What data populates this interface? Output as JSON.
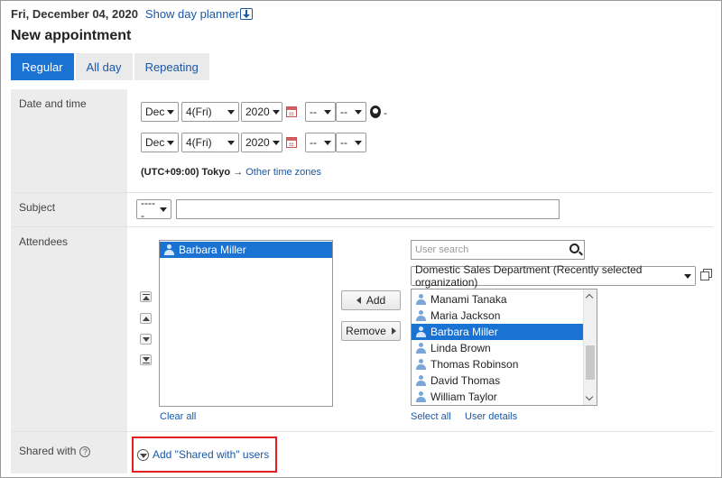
{
  "header": {
    "date": "Fri, December 04, 2020",
    "planner_link": "Show day planner",
    "page_title": "New appointment"
  },
  "tabs": [
    {
      "label": "Regular",
      "active": true
    },
    {
      "label": "All day",
      "active": false
    },
    {
      "label": "Repeating",
      "active": false
    }
  ],
  "labels": {
    "date_time": "Date and time",
    "subject": "Subject",
    "attendees": "Attendees",
    "shared_with": "Shared with"
  },
  "start": {
    "month": "Dec",
    "day": "4(Fri)",
    "year": "2020",
    "hour": "--",
    "minute": "--"
  },
  "end": {
    "month": "Dec",
    "day": "4(Fri)",
    "year": "2020",
    "hour": "--",
    "minute": "--"
  },
  "range_dash": "-",
  "timezone": {
    "label": "(UTC+09:00) Tokyo",
    "arrow": "→",
    "link": "Other time zones"
  },
  "subject": {
    "menu_value": "-----",
    "text": ""
  },
  "attendees": {
    "selected": [
      "Barbara Miller"
    ],
    "clear_all": "Clear all",
    "add_button": "Add",
    "remove_button": "Remove"
  },
  "user_search": {
    "placeholder": "User search",
    "organization": "Domestic Sales Department (Recently selected organization)",
    "candidates": [
      "Manami Tanaka",
      "Maria Jackson",
      "Barbara Miller",
      "Linda Brown",
      "Thomas Robinson",
      "David Thomas",
      "William Taylor"
    ],
    "selected_candidate": "Barbara Miller",
    "select_all": "Select all",
    "user_details": "User details"
  },
  "shared_with": {
    "help": "?",
    "add_link": "Add \"Shared with\" users"
  },
  "colors": {
    "accent": "#1a73d3",
    "link": "#1a57a6",
    "highlight_border": "#e02020",
    "label_bg": "#ececec"
  }
}
